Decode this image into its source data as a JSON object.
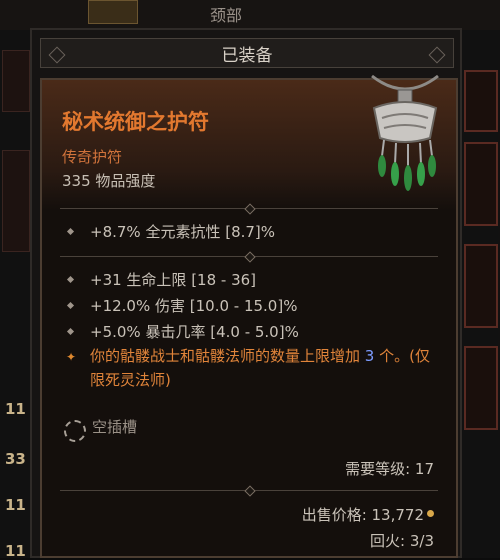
{
  "background": {
    "neck_slot_label": "颈部",
    "left_counts": [
      "11",
      "33",
      "11",
      "11"
    ]
  },
  "panel": {
    "title": "已装备"
  },
  "item": {
    "name": "秘术统御之护符",
    "rarity": "传奇护符",
    "item_power": "335 物品强度",
    "implicit_affixes": [
      "+8.7% 全元素抗性 [8.7]%"
    ],
    "affixes": [
      "+31 生命上限 [18 - 36]",
      "+12.0% 伤害 [10.0 - 15.0]%",
      "+5.0% 暴击几率 [4.0 - 5.0]%"
    ],
    "legendary_power": {
      "text_before": "你的骷髅战士和骷髅法师的数量上限增加 ",
      "value": "3",
      "text_after": " 个。(仅限死灵法师)"
    },
    "socket_label": "空插槽",
    "requirement": "需要等级: 17",
    "sell_price": "出售价格: 13,772",
    "durability": "回火: 3/3"
  },
  "colors": {
    "legendary_orange": "#e2782f",
    "stat_text": "#c9c2b8",
    "highlight_blue": "#7d9cff",
    "gold": "#d9a84a"
  },
  "icons": {
    "amulet": "amulet-icon",
    "legendary": "legendary-star-icon",
    "socket": "empty-socket-icon",
    "gold": "gold-coin-icon"
  }
}
